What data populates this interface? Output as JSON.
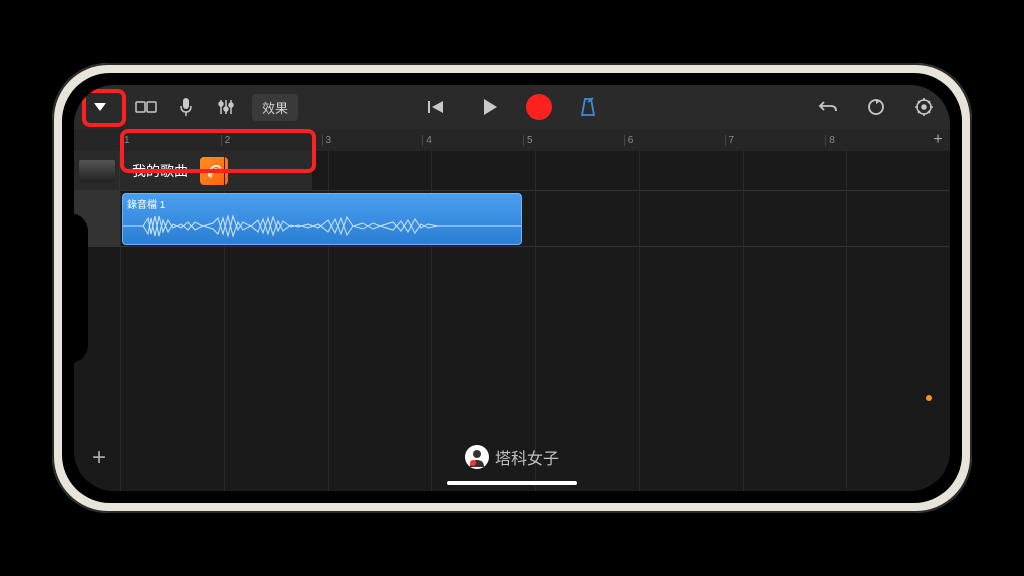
{
  "toolbar": {
    "effects_label": "效果"
  },
  "ruler": {
    "marks": [
      "1",
      "2",
      "3",
      "4",
      "5",
      "6",
      "7",
      "8"
    ]
  },
  "song": {
    "title": "我的歌曲"
  },
  "track": {
    "region_label": "錄音檔 1"
  },
  "watermark": {
    "text": "塔科女子"
  }
}
